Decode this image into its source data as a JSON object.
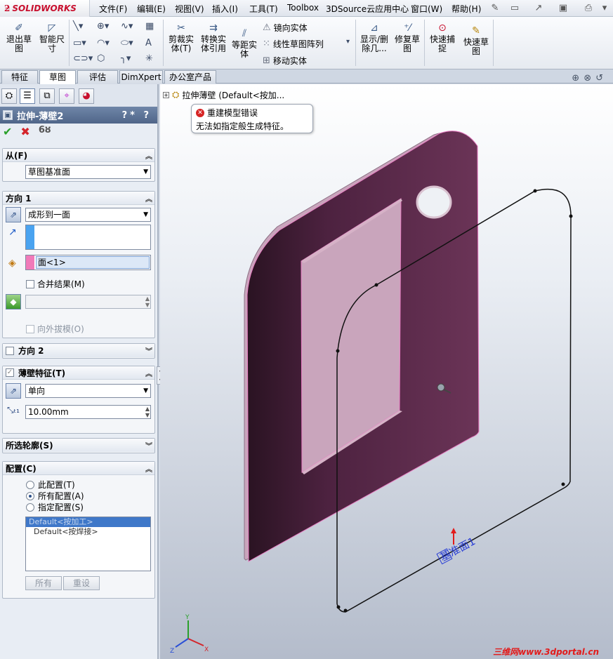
{
  "app": {
    "logo_mark": "ƻ",
    "logo_text": "SOLIDWORKS"
  },
  "menu": [
    "文件(F)",
    "编辑(E)",
    "视图(V)",
    "插入(I)",
    "工具(T)",
    "Toolbox",
    "3DSource云应用中心",
    "窗口(W)",
    "帮助(H)"
  ],
  "ribbon": {
    "exit_sketch": "退出草图",
    "smart_dim": "智能尺寸",
    "trim": "剪裁实体(T)",
    "convert": "转换实体引用",
    "offset": "等距实体",
    "mirror": "镜向实体",
    "linear_pattern": "线性草图阵列",
    "move": "移动实体",
    "display_delete": "显示/删除几...",
    "repair": "修复草图",
    "quick_snap": "快速捕捉",
    "rapid_sketch": "快速草图"
  },
  "tabs": [
    "特征",
    "草图",
    "评估",
    "DimXpert",
    "办公室产品"
  ],
  "panel": {
    "title": "拉伸-薄壁2",
    "help": "?",
    "from": {
      "header": "从(F)",
      "value": "草图基准面"
    },
    "dir1": {
      "header": "方向 1",
      "end_condition": "成形到一面",
      "face_value": "面<1>",
      "merge": "合并结果(M)",
      "draft": "向外拔模(O)"
    },
    "dir2": {
      "header": "方向 2"
    },
    "thin": {
      "header": "薄壁特征(T)",
      "type": "单向",
      "thickness": "10.00mm"
    },
    "contours": {
      "header": "所选轮廓(S)"
    },
    "config": {
      "header": "配置(C)",
      "opt1": "此配置(T)",
      "opt2": "所有配置(A)",
      "opt3": "指定配置(S)",
      "list": [
        "Default<按加工>",
        "Default<按焊接>"
      ],
      "btn_all": "所有",
      "btn_reset": "重设"
    }
  },
  "graphics": {
    "tree_label": "拉伸薄壁  (Default<按加...",
    "error_title": "重建模型错误",
    "error_msg": "无法如指定般生成特征。",
    "plane_label": "基准面1",
    "watermark": "三维网www.3dportal.cn",
    "colors": {
      "part": "#5a2846",
      "edge": "#e97fc4",
      "sketch": "#111111"
    }
  }
}
